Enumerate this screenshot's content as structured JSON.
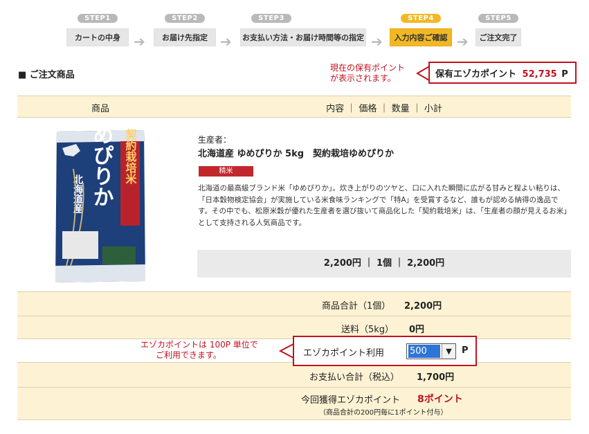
{
  "steps": [
    {
      "tag": "STEP1",
      "label": "カートの中身"
    },
    {
      "tag": "STEP2",
      "label": "お届け先指定"
    },
    {
      "tag": "STEP3",
      "label": "お支払い方法・お届け時間等の指定"
    },
    {
      "tag": "STEP4",
      "label": "入力内容ご確認"
    },
    {
      "tag": "STEP5",
      "label": "ご注文完了"
    }
  ],
  "section_title": "■ ご注文商品",
  "points_note": {
    "line1": "現在の保有ポイント",
    "line2": "が表示されます。"
  },
  "points_box": {
    "label": "保有エゾカポイント",
    "value": "52,735",
    "unit": "P"
  },
  "table_header": {
    "product": "商品",
    "details": "内容 ｜ 価格 ｜ 数量 ｜ 小計"
  },
  "product": {
    "producer_label": "生産者：",
    "name": "北海道産 ゆめぴりか 5kg　契約栽培ゆめぴりか",
    "badge": "精米",
    "description": "北海道の最高級ブランド米「ゆめぴりか」。炊き上がりのツヤと、口に入れた瞬間に広がる甘みと程よい粘りは、「日本穀物検定協会」が実施している米食味ランキングで「特A」を受賞するなど、誰もが認める納得の逸品です。その中でも、松原米穀が優れた生産者を選び抜いて商品化した「契約栽培米」は、「生産者の顔が見えるお米」として支持される人気商品です。",
    "line_total": "2,200円 ｜ 1個 ｜ 2,200円"
  },
  "package": {
    "brand_vertical": "ゆめぴりか",
    "tag_vertical": "契約栽培米",
    "region_vertical": "北海道産"
  },
  "summary": {
    "subtotal_label": "商品合計（1個）",
    "subtotal_value": "2,200円",
    "shipping_label": "送料（5kg）",
    "shipping_value": "0円",
    "use_note_line1": "エゾカポイントは 100P 単位で",
    "use_note_line2": "ご利用できます。",
    "use_label": "エゾカポイント利用",
    "use_value": "500",
    "use_unit": "P",
    "total_label": "お支払い合計（税込）",
    "total_value": "1,700円",
    "earn_label": "今回獲得エゾカポイント",
    "earn_value": "8ポイント",
    "earn_note": "（商品合計の200円毎に1ポイント付与）"
  },
  "colors": {
    "accent": "#f2b824",
    "red": "#c1121f",
    "row_bg": "#fdf3d4"
  }
}
